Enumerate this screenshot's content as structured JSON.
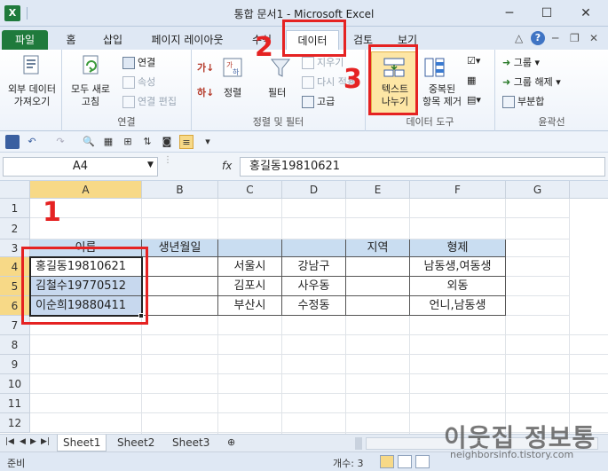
{
  "window": {
    "title": "통합 문서1  -  Microsoft Excel",
    "min": "─",
    "max": "☐",
    "close": "✕"
  },
  "tabs": [
    "파일",
    "홈",
    "삽입",
    "페이지 레이아웃",
    "수식",
    "데이터",
    "검토",
    "보기"
  ],
  "ribbon": {
    "ext_data_label": "외부 데이터\n가져오기",
    "refresh_all": "모두 새로\n고침",
    "connections": "연결",
    "properties": "속성",
    "edit_links": "연결 편집",
    "group_connections": "연결",
    "sort": "정렬",
    "filter": "필터",
    "clear": "지우기",
    "reapply": "다시 적용",
    "advanced": "고급",
    "group_sort_filter": "정렬 및 필터",
    "text_to_columns": "텍스트\n나누기",
    "remove_dup": "중복된\n항목 제거",
    "group_data_tools": "데이터 도구",
    "group_btn": "그룹",
    "ungroup_btn": "그룹 해제",
    "subtotal": "부분합",
    "group_outline": "윤곽선"
  },
  "namebox": "A4",
  "fx": "fx",
  "formula": "홍길동19810621",
  "columns": [
    "A",
    "B",
    "C",
    "D",
    "E",
    "F",
    "G"
  ],
  "rows": [
    "1",
    "2",
    "3",
    "4",
    "5",
    "6",
    "7",
    "8",
    "9",
    "10",
    "11",
    "12"
  ],
  "table": {
    "headers": [
      "이름",
      "생년월일",
      "",
      "",
      "지역",
      "형제"
    ],
    "data": [
      [
        "홍길동19810621",
        "",
        "서울시",
        "강남구",
        "",
        "남동생,여동생"
      ],
      [
        "김철수19770512",
        "",
        "김포시",
        "사우동",
        "",
        "외동"
      ],
      [
        "이순희19880411",
        "",
        "부산시",
        "수정동",
        "",
        "언니,남동생"
      ]
    ]
  },
  "annotations": {
    "step1": "1",
    "step2": "2",
    "step3": "3"
  },
  "sheets": [
    "Sheet1",
    "Sheet2",
    "Sheet3"
  ],
  "status": {
    "mode": "준비",
    "count": "개수: 3"
  },
  "watermark": {
    "text": "이웃집 정보통",
    "url": "neighborsinfo.tistory.com"
  },
  "colors": {
    "excel_green": "#1f7a3c",
    "annotation_red": "#e52222",
    "selected_header": "#f7d987"
  }
}
